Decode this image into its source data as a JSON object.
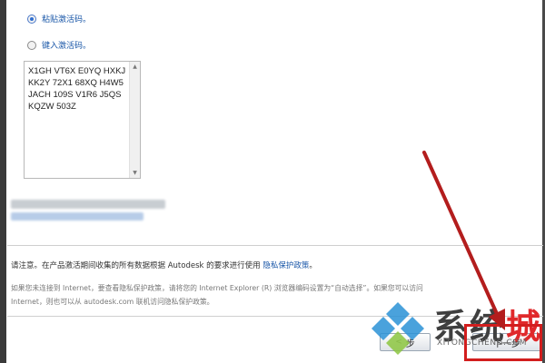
{
  "options": [
    {
      "label": "粘贴激活码。",
      "checked": true
    },
    {
      "label": "键入激活码。",
      "checked": false
    }
  ],
  "activation_code": "X1GH VT6X E0YQ HXKJ\nKK2Y 72X1 68XQ H4W5\nJACH 109S V1R6 J5QS\nKQZW 503Z",
  "notice": {
    "text": "请注意。在产品激活期间收集的所有数据根据 Autodesk 的要求进行使用",
    "link": "隐私保护政策",
    "end": "。"
  },
  "info_lines": [
    "如果您未连接到 Internet，要查看隐私保护政策，请将您的 Internet Explorer (R) 浏览器编码设置为“自动选择”。如果您可以访问",
    "Internet，则也可以从 autodesk.com 联机访问隐私保护政策。"
  ],
  "buttons": {
    "back": "步",
    "next": "下一步"
  },
  "watermark": {
    "title_main": "系统",
    "title_accent": "城",
    "subtitle": "XITONGCHENG.COM"
  },
  "colors": {
    "link": "#1a57a8",
    "annotation_red": "#d21e1e"
  }
}
